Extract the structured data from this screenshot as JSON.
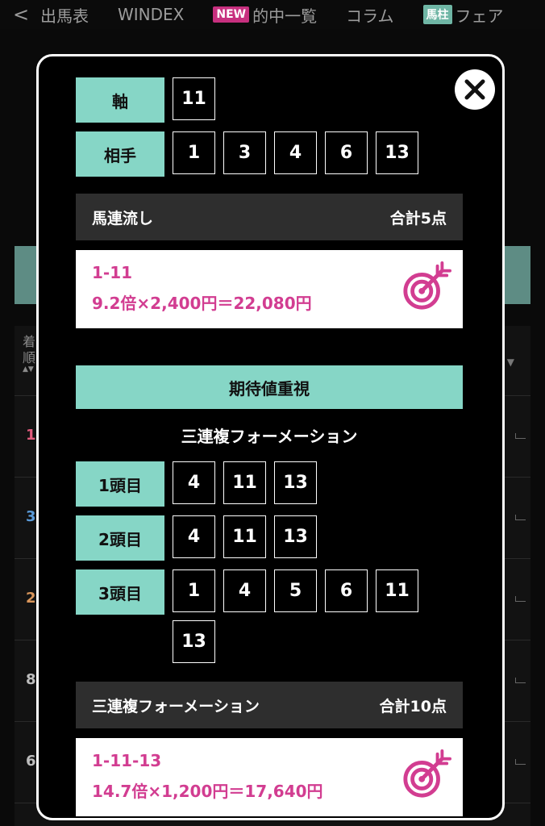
{
  "nav": {
    "back": "<",
    "items": [
      {
        "label": "出馬表"
      },
      {
        "label": "WINDEX"
      },
      {
        "badge": "NEW",
        "label": "的中一覧"
      },
      {
        "label": "コラム"
      },
      {
        "badge": "馬柱",
        "label": "フェア"
      }
    ]
  },
  "background_table": {
    "header_label": "着順",
    "sort_arrows": "▲▼",
    "column_arrow": "▼",
    "ranks": [
      {
        "value": "1",
        "color": "#e05a7c"
      },
      {
        "value": "3",
        "color": "#5a9ad8"
      },
      {
        "value": "2",
        "color": "#d8955a"
      },
      {
        "value": "8",
        "color": "#bdbdbd"
      },
      {
        "value": "6",
        "color": "#bdbdbd"
      }
    ]
  },
  "modal": {
    "close_icon": "✕",
    "bet1": {
      "axis_label": "軸",
      "axis_numbers": [
        "11"
      ],
      "partner_label": "相手",
      "partner_numbers": [
        "1",
        "3",
        "4",
        "6",
        "13"
      ],
      "type": "馬連流し",
      "total": "合計5点",
      "hit_combo": "1-11",
      "hit_calc": "9.2倍×2,400円＝22,080円"
    },
    "strategy_title": "期待値重視",
    "formation_title": "三連複フォーメーション",
    "formation": [
      {
        "label": "1頭目",
        "numbers": [
          "4",
          "11",
          "13"
        ]
      },
      {
        "label": "2頭目",
        "numbers": [
          "4",
          "11",
          "13"
        ]
      },
      {
        "label": "3頭目",
        "numbers": [
          "1",
          "4",
          "5",
          "6",
          "11"
        ]
      }
    ],
    "formation_extra": [
      "13"
    ],
    "bet2": {
      "type": "三連複フォーメーション",
      "total": "合計10点",
      "hit_combo": "1-11-13",
      "hit_calc": "14.7倍×1,200円＝17,640円"
    }
  },
  "colors": {
    "accent_teal": "#86d6c6",
    "hit_pink": "#d23d91",
    "new_badge": "#c7307f"
  }
}
